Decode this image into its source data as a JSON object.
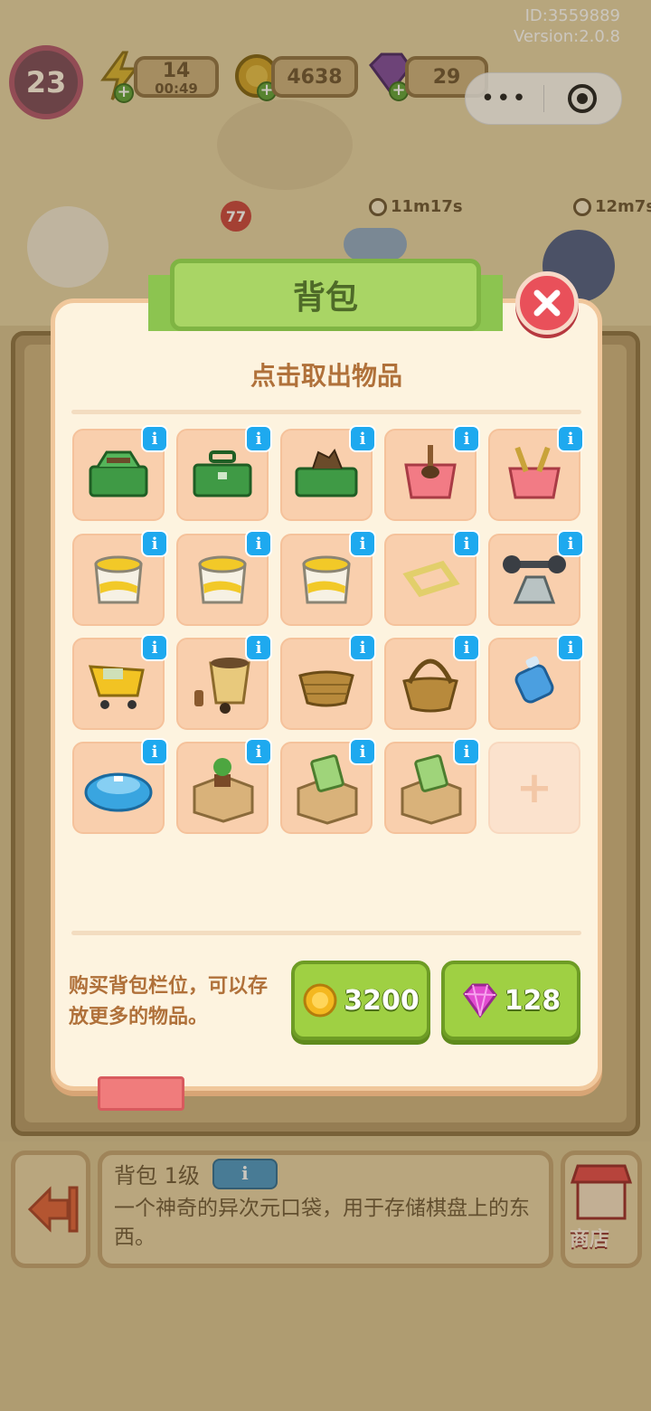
{
  "header": {
    "player_id": "ID:3559889",
    "version": "Version:2.0.8",
    "level": "23",
    "energy": "14",
    "energy_timer": "00:49",
    "coins": "4638",
    "gems": "29",
    "timers": [
      "11m17s",
      "12m7s"
    ],
    "board_badge": "77",
    "capsule_more": "•••"
  },
  "modal": {
    "title": "背包",
    "subtitle": "点击取出物品",
    "items": [
      {
        "name": "green-toolbox-tools"
      },
      {
        "name": "green-toolbox-closed"
      },
      {
        "name": "green-toolbox-open"
      },
      {
        "name": "pink-bin-shovel"
      },
      {
        "name": "pink-bin-tools"
      },
      {
        "name": "paint-bucket"
      },
      {
        "name": "paint-bucket"
      },
      {
        "name": "paint-bucket"
      },
      {
        "name": "yellow-frame"
      },
      {
        "name": "dumbbell-rack"
      },
      {
        "name": "shopping-cart"
      },
      {
        "name": "flower-pot-bottles"
      },
      {
        "name": "wicker-bowl"
      },
      {
        "name": "wicker-basket"
      },
      {
        "name": "water-jug"
      },
      {
        "name": "robot-vacuum"
      },
      {
        "name": "box-with-plant"
      },
      {
        "name": "box-with-notebook"
      },
      {
        "name": "box-with-notebook"
      }
    ],
    "empty_slot_symbol": "+",
    "buy_text": "购买背包栏位，可以存放更多的物品。",
    "buy_coin_price": "3200",
    "buy_gem_price": "128",
    "close_symbol": "×"
  },
  "info_panel": {
    "title": "背包 1级",
    "info_label": "i",
    "description": "一个神奇的异次元口袋，用于存储棋盘上的东西。",
    "shop_label": "商店"
  },
  "colors": {
    "ribbon": "#a9d565",
    "buy_button": "#9fd043",
    "slot": "#f9cfad",
    "info_badge": "#1ea9ef",
    "close": "#e9505a"
  }
}
